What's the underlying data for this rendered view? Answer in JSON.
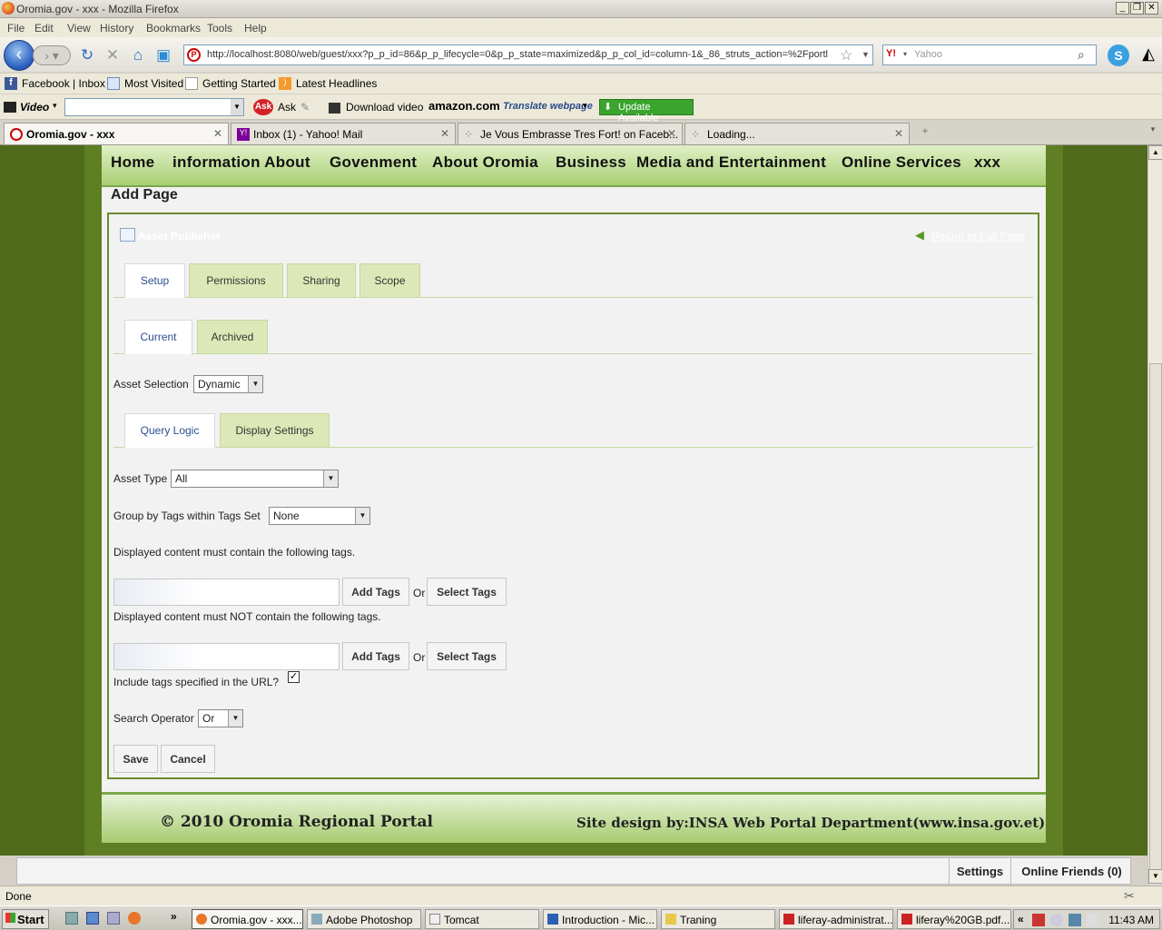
{
  "window": {
    "title": "Oromia.gov - xxx - Mozilla Firefox"
  },
  "menu": [
    "File",
    "Edit",
    "View",
    "History",
    "Bookmarks",
    "Tools",
    "Help"
  ],
  "nav": {
    "url": "http://localhost:8080/web/guest/xxx?p_p_id=86&p_p_lifecycle=0&p_p_state=maximized&p_p_col_id=column-1&_86_struts_action=%2Fportl",
    "search_placeholder": "Yahoo",
    "search_engine": "Y!"
  },
  "bookmarks": [
    "Facebook | Inbox",
    "Most Visited",
    "Getting Started",
    "Latest Headlines"
  ],
  "toolbar2": {
    "video": "Video",
    "ask": "Ask",
    "download": "Download video",
    "amazon": "amazon.com",
    "translate": "Translate webpage",
    "update": "Update Available"
  },
  "tabs": [
    {
      "label": "Oromia.gov - xxx"
    },
    {
      "label": "Inbox (1) - Yahoo! Mail"
    },
    {
      "label": "Je Vous Embrasse Tres Fort! on Faceb..."
    },
    {
      "label": "Loading..."
    }
  ],
  "site": {
    "topnav": [
      "Home",
      "information About",
      "Govenment",
      "About Oromia",
      "Business",
      "Media and Entertainment",
      "Online Services",
      "xxx"
    ],
    "page_title": "Add Page",
    "portlet_title": "Asset Publisher",
    "return_link": "Return to Full Page",
    "tabs_main": [
      "Setup",
      "Permissions",
      "Sharing",
      "Scope"
    ],
    "tabs_sub": [
      "Current",
      "Archived"
    ],
    "asset_selection_label": "Asset Selection",
    "asset_selection_value": "Dynamic",
    "tabs_query": [
      "Query Logic",
      "Display Settings"
    ],
    "asset_type_label": "Asset Type",
    "asset_type_value": "All",
    "group_by_label": "Group by Tags within Tags Set",
    "group_by_value": "None",
    "contain_text": "Displayed content must contain the following tags.",
    "not_contain_text": "Displayed content must NOT contain the following tags.",
    "add_tags": "Add Tags",
    "or": "Or",
    "select_tags": "Select Tags",
    "include_url_label": "Include tags specified in the URL?",
    "include_url_checked": true,
    "search_operator_label": "Search Operator",
    "search_operator_value": "Or",
    "save": "Save",
    "cancel": "Cancel",
    "footer_left": "© 2010 Oromia Regional Portal",
    "footer_right": "Site design by:INSA Web Portal Department(www.insa.gov.et)"
  },
  "dock": {
    "settings": "Settings",
    "friends": "Online Friends (0)"
  },
  "status": "Done",
  "taskbar": {
    "start": "Start",
    "tasks": [
      "Oromia.gov - xxx...",
      "Adobe Photoshop",
      "Tomcat",
      "Introduction - Mic...",
      "Traning",
      "liferay-administrat...",
      "liferay%20GB.pdf..."
    ],
    "clock": "11:43 AM"
  }
}
